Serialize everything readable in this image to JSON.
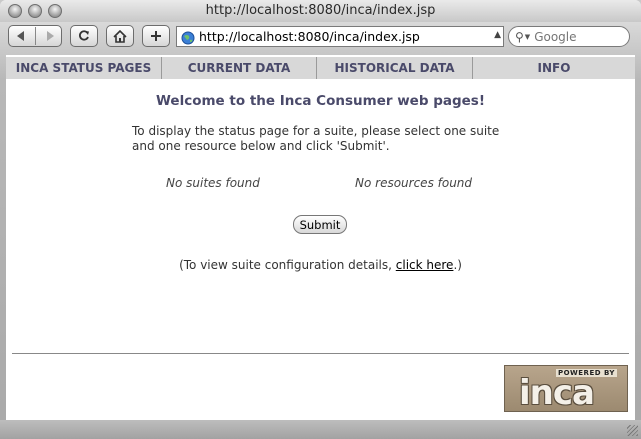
{
  "window": {
    "title": "http://localhost:8080/inca/index.jsp"
  },
  "toolbar": {
    "url": "http://localhost:8080/inca/index.jsp",
    "search_placeholder": "Google"
  },
  "nav": {
    "items": [
      {
        "label": "INCA STATUS PAGES"
      },
      {
        "label": "CURRENT DATA"
      },
      {
        "label": "HISTORICAL DATA"
      },
      {
        "label": "INFO"
      }
    ]
  },
  "main": {
    "heading": "Welcome to the Inca Consumer web pages!",
    "intro": "To display the status page for a suite, please select one suite and one resource below and click 'Submit'.",
    "no_suites": "No suites found",
    "no_resources": "No resources found",
    "submit_label": "Submit",
    "config_prefix": "(To view suite configuration details, ",
    "config_link": "click here",
    "config_suffix": ".)"
  },
  "footer": {
    "badge_top": "POWERED BY",
    "badge_logo": "inca"
  }
}
